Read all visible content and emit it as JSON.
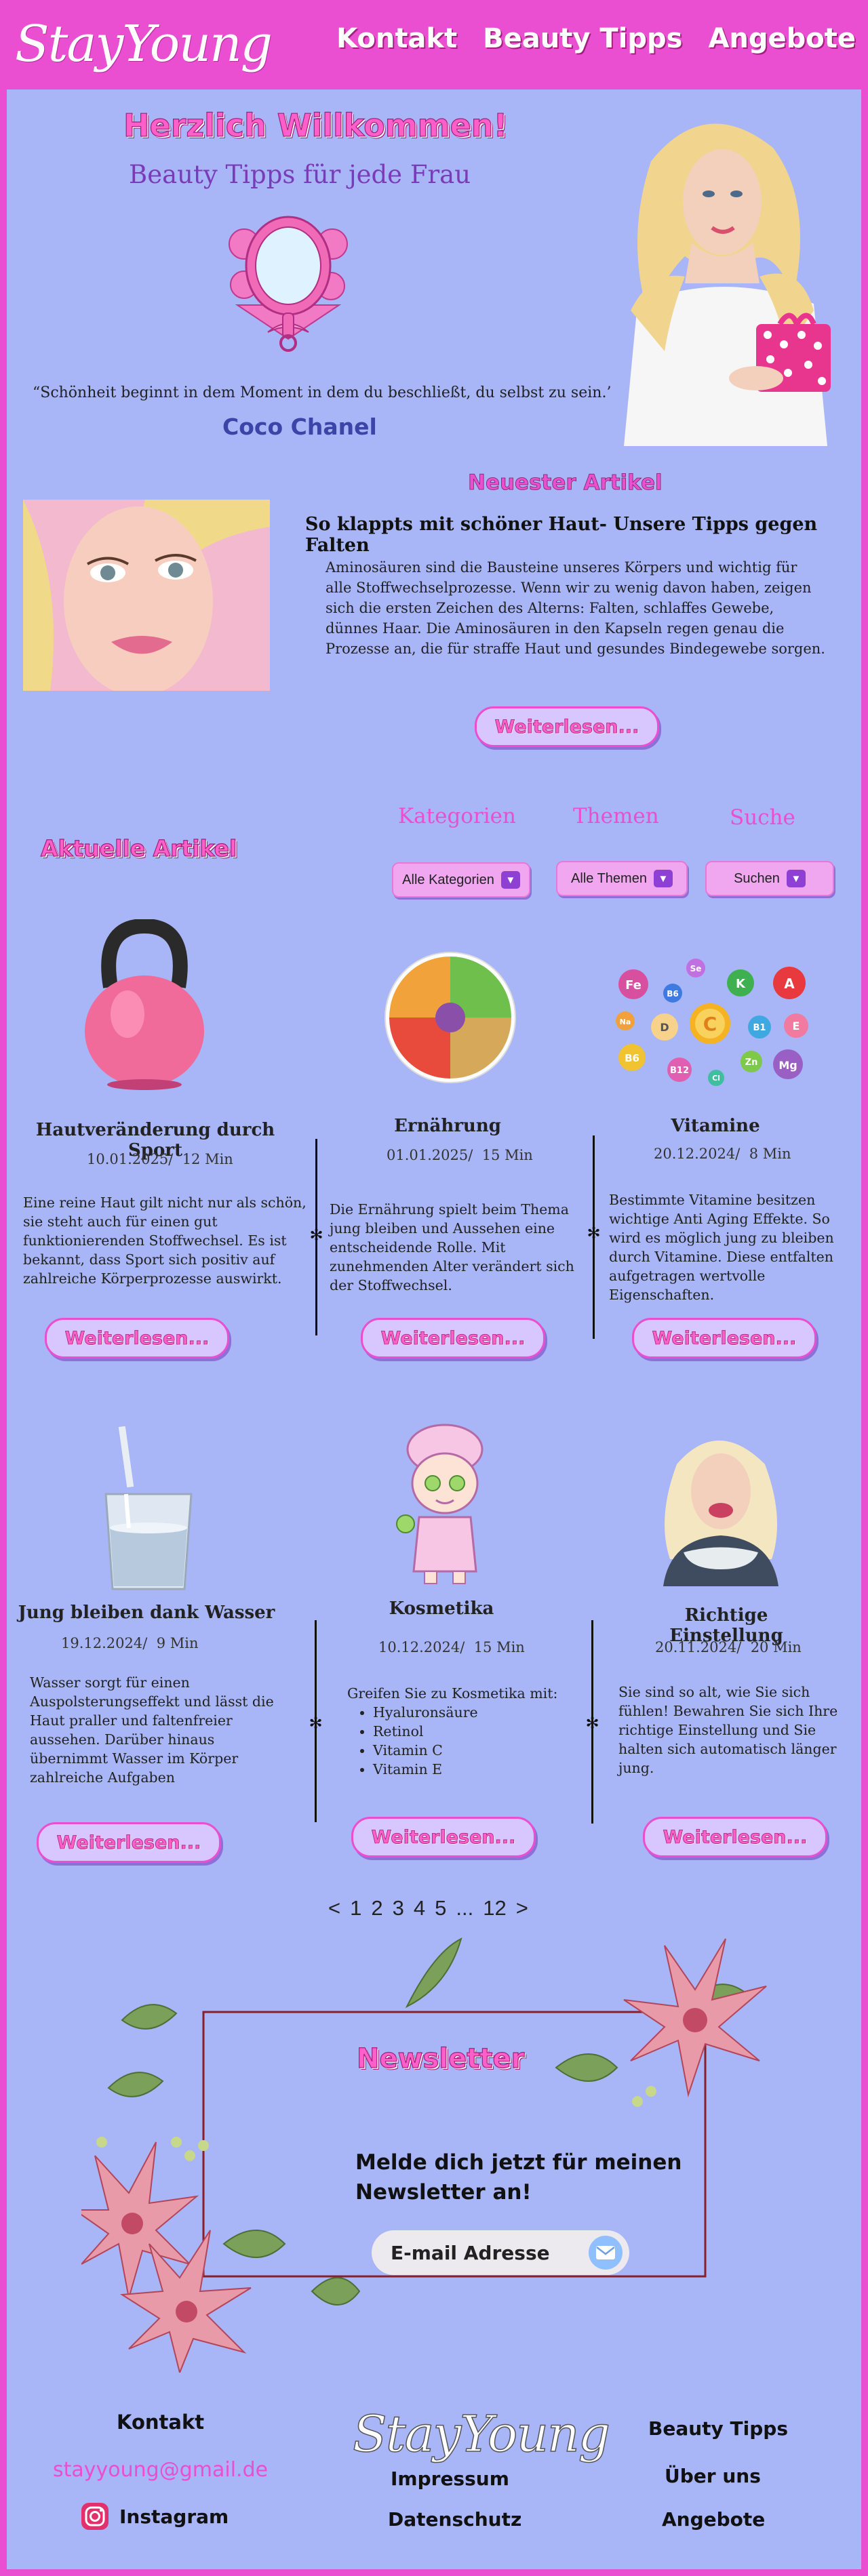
{
  "header": {
    "logo": "StayYoung",
    "nav": [
      "Kontakt",
      "Beauty Tipps",
      "Angebote"
    ]
  },
  "hero": {
    "welcome": "Herzlich Willkommen!",
    "subtitle": "Beauty Tipps für jede Frau",
    "quote": "“Schönheit beginnt in dem Moment in dem du beschließt, du selbst zu sein.”",
    "quote_author": "Coco Chanel"
  },
  "latest": {
    "heading": "Neuester Artikel",
    "title": "So klappts mit schöner Haut- Unsere Tipps gegen Falten",
    "text": "Aminosäuren sind die Bausteine unseres Körpers und wichtig für alle Stoffwechselprozesse. Wenn wir zu wenig davon haben, zeigen sich die ersten Zeichen des Alterns: Falten, schlaffes Gewebe, dünnes Haar. Die Aminosäuren in den Kapseln regen genau die Prozesse an, die für straffe Haut und gesundes Bindegewebe sorgen.",
    "button": "Weiterlesen..."
  },
  "filters": {
    "current_articles": "Aktuelle Artikel",
    "kategorien_label": "Kategorien",
    "themen_label": "Themen",
    "suche_label": "Suche",
    "kategorien_value": "Alle Kategorien",
    "themen_value": "Alle Themen",
    "suche_value": "Suchen"
  },
  "articles": [
    {
      "title": "Hautveränderung durch Sport",
      "date": "10.01.2025",
      "duration": "12 Min",
      "text": "Eine reine Haut gilt nicht nur als schön, sie steht auch für einen gut funktionierenden Stoffwechsel. Es ist bekannt, dass Sport sich positiv auf zahlreiche Körperprozesse auswirkt.",
      "button": "Weiterlesen..."
    },
    {
      "title": "Ernährung",
      "date": "01.01.2025",
      "duration": "15 Min",
      "text": "Die Ernährung spielt beim Thema jung bleiben und Aussehen eine entscheidende Rolle. Mit zunehmenden Alter verändert sich der Stoffwechsel.",
      "button": "Weiterlesen..."
    },
    {
      "title": "Vitamine",
      "date": "20.12.2024",
      "duration": "8 Min",
      "text": "Bestimmte Vitamine besitzen wichtige Anti Aging Effekte. So wird es möglich jung zu bleiben durch Vitamine. Diese entfalten aufgetragen wertvolle Eigenschaften.",
      "button": "Weiterlesen..."
    },
    {
      "title": "Jung bleiben dank Wasser",
      "date": "19.12.2024",
      "duration": "9 Min",
      "text": "Wasser sorgt für einen Auspolsterungseffekt und lässt die Haut praller und faltenfreier aussehen. Darüber hinaus übernimmt Wasser im Körper zahlreiche Aufgaben",
      "button": "Weiterlesen..."
    },
    {
      "title": "Kosmetika",
      "date": "10.12.2024",
      "duration": "15 Min",
      "text": "Greifen Sie zu Kosmetika mit:",
      "list": [
        "Hyaluronsäure",
        "Retinol",
        "Vitamin C",
        "Vitamin E"
      ],
      "button": "Weiterlesen..."
    },
    {
      "title": "Richtige Einstellung",
      "date": "20.11.2024",
      "duration": "20 Min",
      "text": "Sie sind so alt, wie Sie sich fühlen! Bewahren Sie sich Ihre richtige Einstellung und Sie halten sich automatisch länger jung.",
      "button": "Weiterlesen..."
    }
  ],
  "pagination": [
    "<",
    "1",
    "2",
    "3",
    "4",
    "5",
    "...",
    "12",
    ">"
  ],
  "vitamins": [
    "Fe",
    "Se",
    "K",
    "A",
    "Mg",
    "E",
    "B6",
    "D",
    "C",
    "B1",
    "B3",
    "B12",
    "Cl",
    "Zn",
    "Mg",
    "Na"
  ],
  "newsletter": {
    "heading": "Newsletter",
    "text": "Melde dich jetzt für meinen Newsletter an!",
    "placeholder": "E-mail Adresse"
  },
  "footer": {
    "contact_heading": "Kontakt",
    "email": "stayyoung@gmail.de",
    "instagram": "Instagram",
    "logo": "StayYoung",
    "impressum": "Impressum",
    "datenschutz": "Datenschutz",
    "beauty": "Beauty Tipps",
    "about": "Über uns",
    "angebote": "Angebote"
  },
  "colors": {
    "primary_pink": "#e94fd0",
    "background": "#a8b5f6",
    "accent_purple": "#8e3fd4"
  }
}
